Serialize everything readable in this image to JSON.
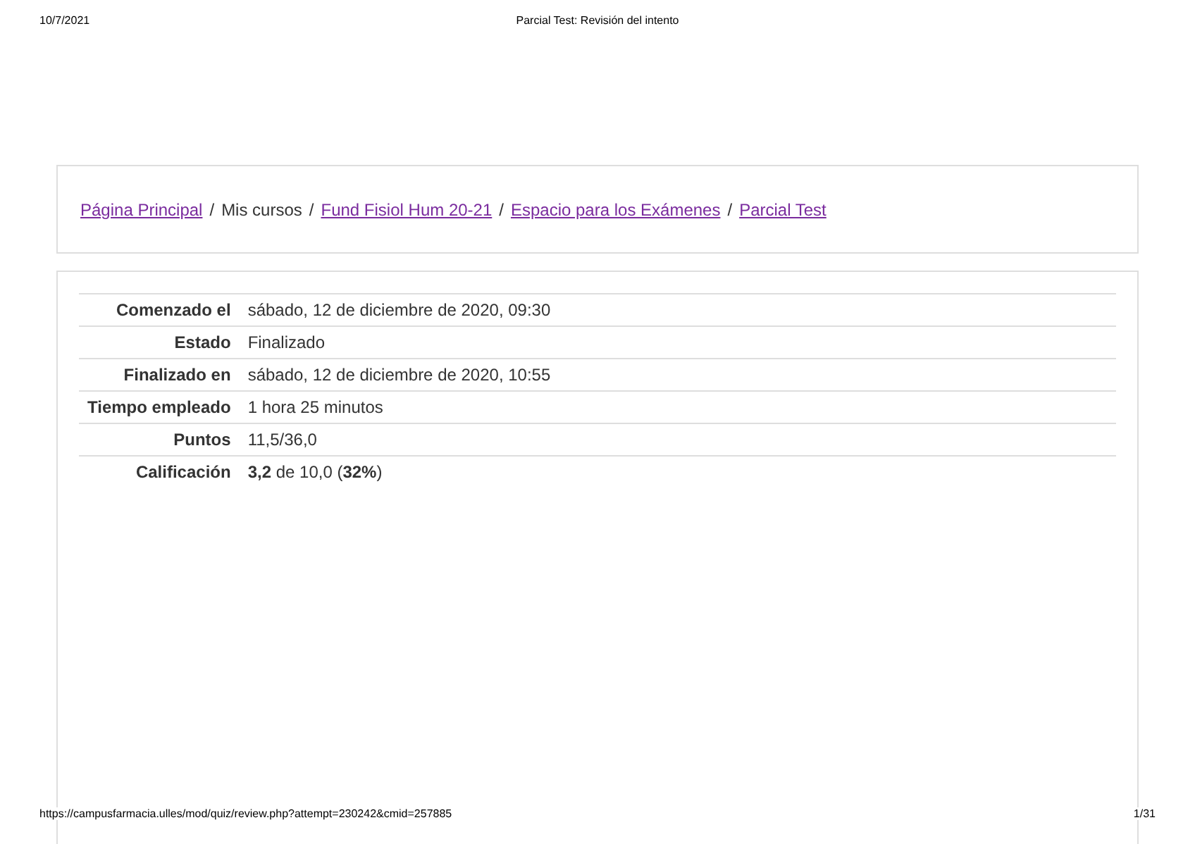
{
  "print_header": {
    "date": "10/7/2021",
    "title": "Parcial Test: Revisión del intento"
  },
  "breadcrumb": [
    {
      "label": "Página Principal",
      "kind": "link"
    },
    {
      "label": "Mis cursos",
      "kind": "text"
    },
    {
      "label": "Fund Fisiol Hum 20-21",
      "kind": "link"
    },
    {
      "label": "Espacio para los Exámenes",
      "kind": "link"
    },
    {
      "label": "Parcial Test",
      "kind": "link"
    }
  ],
  "breadcrumb_separator": "/",
  "summary": [
    {
      "label": "Comenzado el",
      "value": "sábado, 12 de diciembre de 2020, 09:30"
    },
    {
      "label": "Estado",
      "value": "Finalizado"
    },
    {
      "label": "Finalizado en",
      "value": "sábado, 12 de diciembre de 2020, 10:55"
    },
    {
      "label": "Tiempo empleado",
      "value": "1 hora 25 minutos"
    },
    {
      "label": "Puntos",
      "value": "11,5/36,0"
    },
    {
      "label": "Calificación",
      "value": "**3,2** de 10,0 (**32%**)"
    }
  ],
  "print_footer": {
    "url": "https://campusfarmacia.ulles/mod/quiz/review.php?attempt=230242&cmid=257885",
    "page": "1/31"
  }
}
